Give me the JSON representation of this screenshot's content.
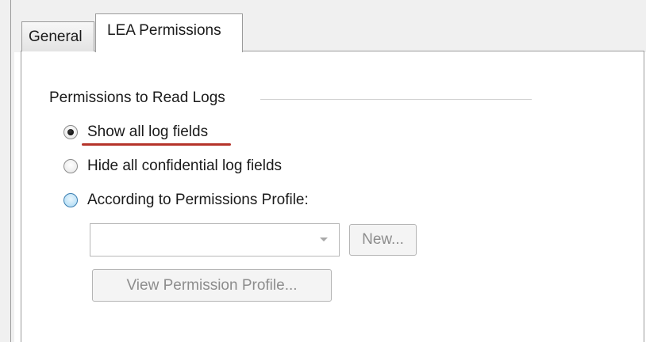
{
  "tabs": [
    {
      "label": "General"
    },
    {
      "label": "LEA Permissions"
    }
  ],
  "group": {
    "title": "Permissions to Read Logs"
  },
  "options": [
    {
      "label": "Show all log fields",
      "selected": true
    },
    {
      "label": "Hide all confidential log fields",
      "selected": false
    },
    {
      "label": "According to Permissions Profile:",
      "selected": false
    }
  ],
  "profile": {
    "selected_value": "",
    "new_button": "New...",
    "view_button": "View Permission Profile..."
  },
  "colors": {
    "annotation_underline": "#b5332a",
    "radio_hover": "#a7d8f4"
  }
}
